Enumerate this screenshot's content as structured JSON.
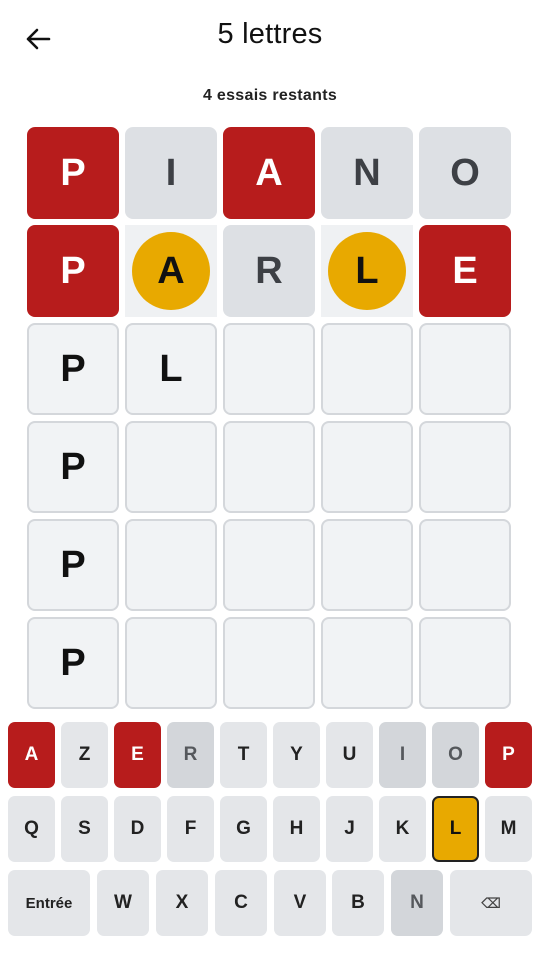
{
  "header": {
    "title": "5 lettres",
    "subtitle": "4 essais restants",
    "back_icon": "arrow-left-icon"
  },
  "colors": {
    "correct": "#b71c1c",
    "present": "#e8a900",
    "absent": "#dde0e4",
    "empty": "#f1f3f5"
  },
  "board": [
    [
      {
        "letter": "P",
        "state": "correct"
      },
      {
        "letter": "I",
        "state": "absent"
      },
      {
        "letter": "A",
        "state": "correct"
      },
      {
        "letter": "N",
        "state": "absent"
      },
      {
        "letter": "O",
        "state": "absent"
      }
    ],
    [
      {
        "letter": "P",
        "state": "correct"
      },
      {
        "letter": "A",
        "state": "present"
      },
      {
        "letter": "R",
        "state": "absent"
      },
      {
        "letter": "L",
        "state": "present"
      },
      {
        "letter": "E",
        "state": "correct"
      }
    ],
    [
      {
        "letter": "P",
        "state": "empty"
      },
      {
        "letter": "L",
        "state": "empty"
      },
      {
        "letter": "",
        "state": "empty"
      },
      {
        "letter": "",
        "state": "empty"
      },
      {
        "letter": "",
        "state": "empty"
      }
    ],
    [
      {
        "letter": "P",
        "state": "empty"
      },
      {
        "letter": "",
        "state": "empty"
      },
      {
        "letter": "",
        "state": "empty"
      },
      {
        "letter": "",
        "state": "empty"
      },
      {
        "letter": "",
        "state": "empty"
      }
    ],
    [
      {
        "letter": "P",
        "state": "empty"
      },
      {
        "letter": "",
        "state": "empty"
      },
      {
        "letter": "",
        "state": "empty"
      },
      {
        "letter": "",
        "state": "empty"
      },
      {
        "letter": "",
        "state": "empty"
      }
    ],
    [
      {
        "letter": "P",
        "state": "empty"
      },
      {
        "letter": "",
        "state": "empty"
      },
      {
        "letter": "",
        "state": "empty"
      },
      {
        "letter": "",
        "state": "empty"
      },
      {
        "letter": "",
        "state": "empty"
      }
    ]
  ],
  "keyboard": {
    "rows": [
      [
        {
          "label": "A",
          "state": "correct"
        },
        {
          "label": "Z",
          "state": "unused"
        },
        {
          "label": "E",
          "state": "correct"
        },
        {
          "label": "R",
          "state": "absent"
        },
        {
          "label": "T",
          "state": "unused"
        },
        {
          "label": "Y",
          "state": "unused"
        },
        {
          "label": "U",
          "state": "unused"
        },
        {
          "label": "I",
          "state": "absent"
        },
        {
          "label": "O",
          "state": "absent"
        },
        {
          "label": "P",
          "state": "correct"
        }
      ],
      [
        {
          "label": "Q",
          "state": "unused"
        },
        {
          "label": "S",
          "state": "unused"
        },
        {
          "label": "D",
          "state": "unused"
        },
        {
          "label": "F",
          "state": "unused"
        },
        {
          "label": "G",
          "state": "unused"
        },
        {
          "label": "H",
          "state": "unused"
        },
        {
          "label": "J",
          "state": "unused"
        },
        {
          "label": "K",
          "state": "unused"
        },
        {
          "label": "L",
          "state": "present"
        },
        {
          "label": "M",
          "state": "unused"
        }
      ],
      [
        {
          "label": "Entrée",
          "state": "unused",
          "kind": "enter"
        },
        {
          "label": "W",
          "state": "unused"
        },
        {
          "label": "X",
          "state": "unused"
        },
        {
          "label": "C",
          "state": "unused"
        },
        {
          "label": "V",
          "state": "unused"
        },
        {
          "label": "B",
          "state": "unused"
        },
        {
          "label": "N",
          "state": "absent"
        },
        {
          "label": "⌫",
          "state": "unused",
          "kind": "back"
        }
      ]
    ]
  }
}
